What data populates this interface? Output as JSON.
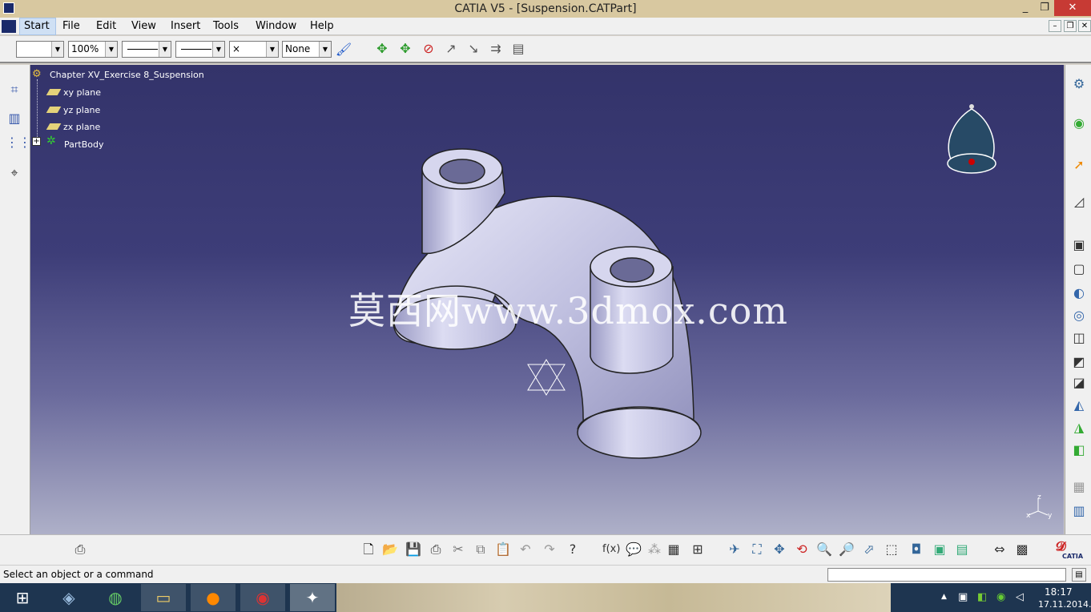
{
  "window": {
    "title": "CATIA V5 - [Suspension.CATPart]"
  },
  "menu": {
    "start": "Start",
    "file": "File",
    "edit": "Edit",
    "view": "View",
    "insert": "Insert",
    "tools": "Tools",
    "window": "Window",
    "help": "Help"
  },
  "toolbar": {
    "zoom_value": "100%",
    "none_value": "None",
    "x_value": "×"
  },
  "tree": {
    "root": "Chapter XV_Exercise 8_Suspension",
    "items": [
      "xy plane",
      "yz plane",
      "zx plane",
      "PartBody"
    ]
  },
  "watermark": "莫西网www.3dmox.com",
  "axis": {
    "x": "x",
    "y": "y",
    "z": "z"
  },
  "status": {
    "message": "Select an object or a command",
    "command_value": ""
  },
  "brand": {
    "catia_label": "CATIA"
  },
  "taskbar": {
    "time": "18:17",
    "date": "17.11.2014."
  },
  "colors": {
    "viewport_top": "#33336a",
    "viewport_bottom": "#aeb0c8",
    "part_fill": "#c8c8e6"
  }
}
